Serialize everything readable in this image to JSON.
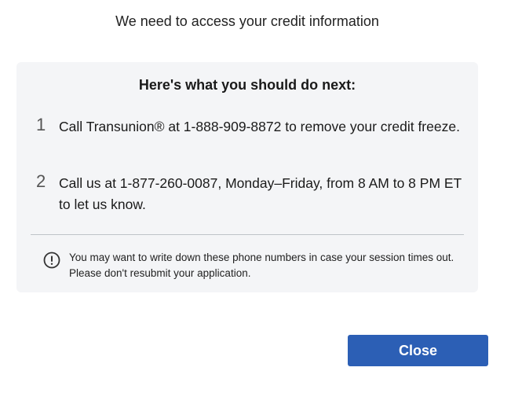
{
  "header": {
    "title": "We need to access your credit information"
  },
  "panel": {
    "heading": "Here's what you should do next:",
    "steps": [
      {
        "number": "1",
        "text": "Call Transunion® at 1-888-909-8872 to remove your credit freeze."
      },
      {
        "number": "2",
        "text": "Call us at 1-877-260-0087, Monday–Friday, from 8 AM to 8 PM ET to let us know."
      }
    ],
    "note": {
      "icon": "exclamation-circle-icon",
      "text": "You may want to write down these phone numbers in case your session times out. Please don't resubmit your application."
    }
  },
  "actions": {
    "close_label": "Close"
  },
  "colors": {
    "primary_button": "#2c5fb5",
    "panel_background": "#f4f5f7",
    "divider": "#bfc3c8"
  }
}
